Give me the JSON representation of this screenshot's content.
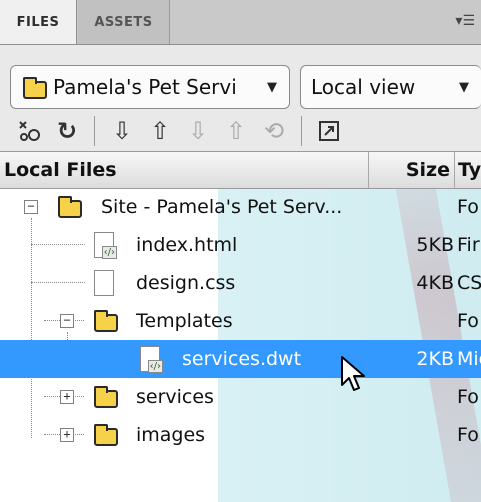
{
  "tabs": [
    {
      "label": "FILES"
    },
    {
      "label": "ASSETS"
    }
  ],
  "panel_menu_icon": "panel-menu-icon",
  "toolbar": {
    "site_select": "Pamela's Pet Servi",
    "view_select": "Local view"
  },
  "columns": {
    "name": "Local Files",
    "size": "Size",
    "type": "Ty"
  },
  "tree": [
    {
      "label": "Site - Pamela's Pet Serv...",
      "size": "",
      "type": "Fo"
    },
    {
      "label": "index.html",
      "size": "5KB",
      "type": "Fir"
    },
    {
      "label": "design.css",
      "size": "4KB",
      "type": "CS"
    },
    {
      "label": "Templates",
      "size": "",
      "type": "Fo"
    },
    {
      "label": "services.dwt",
      "size": "2KB",
      "type": "Mic"
    },
    {
      "label": "services",
      "size": "",
      "type": "Fo"
    },
    {
      "label": "images",
      "size": "",
      "type": "Fo"
    }
  ],
  "expanders": {
    "site": "−",
    "templates": "−",
    "services": "+",
    "images": "+"
  },
  "colors": {
    "selection": "#3399ff",
    "folder": "#f6d24a",
    "background_accent": "#d3eef2"
  }
}
